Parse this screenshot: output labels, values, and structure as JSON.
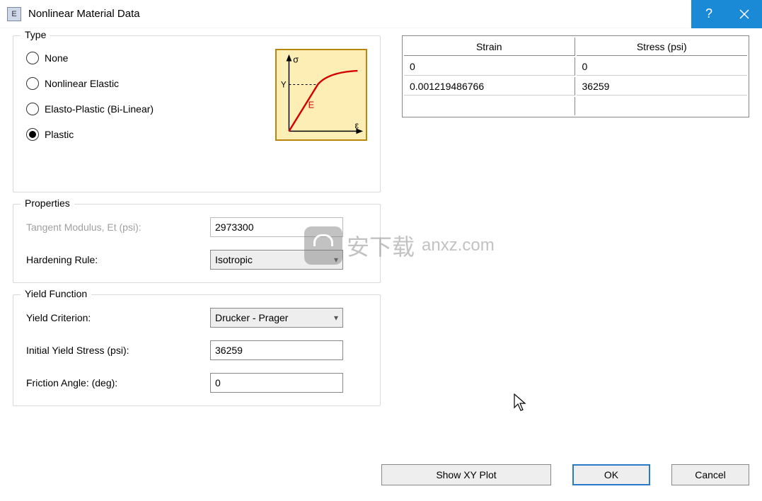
{
  "window": {
    "title": "Nonlinear Material Data"
  },
  "type_group": {
    "title": "Type",
    "options": {
      "none": "None",
      "nonlinear_elastic": "Nonlinear Elastic",
      "elasto_plastic": "Elasto-Plastic (Bi-Linear)",
      "plastic": "Plastic"
    },
    "selected": "plastic",
    "diagram": {
      "sigma": "σ",
      "epsilon": "ε",
      "y": "Y",
      "e": "E"
    }
  },
  "properties_group": {
    "title": "Properties",
    "tangent_label": "Tangent Modulus, Et (psi):",
    "tangent_value": "2973300",
    "hardening_label": "Hardening Rule:",
    "hardening_value": "Isotropic"
  },
  "yield_group": {
    "title": "Yield Function",
    "criterion_label": "Yield Criterion:",
    "criterion_value": "Drucker - Prager",
    "initial_label": "Initial Yield Stress (psi):",
    "initial_value": "36259",
    "friction_label": "Friction Angle: (deg):",
    "friction_value": "0"
  },
  "table": {
    "headers": {
      "strain": "Strain",
      "stress": "Stress (psi)"
    },
    "rows": [
      {
        "strain": "0",
        "stress": "0"
      },
      {
        "strain": "0.001219486766",
        "stress": "36259"
      },
      {
        "strain": "",
        "stress": ""
      }
    ]
  },
  "buttons": {
    "show_plot": "Show XY Plot",
    "ok": "OK",
    "cancel": "Cancel"
  },
  "watermark": {
    "cn": "安下载",
    "url": "anxz.com"
  }
}
